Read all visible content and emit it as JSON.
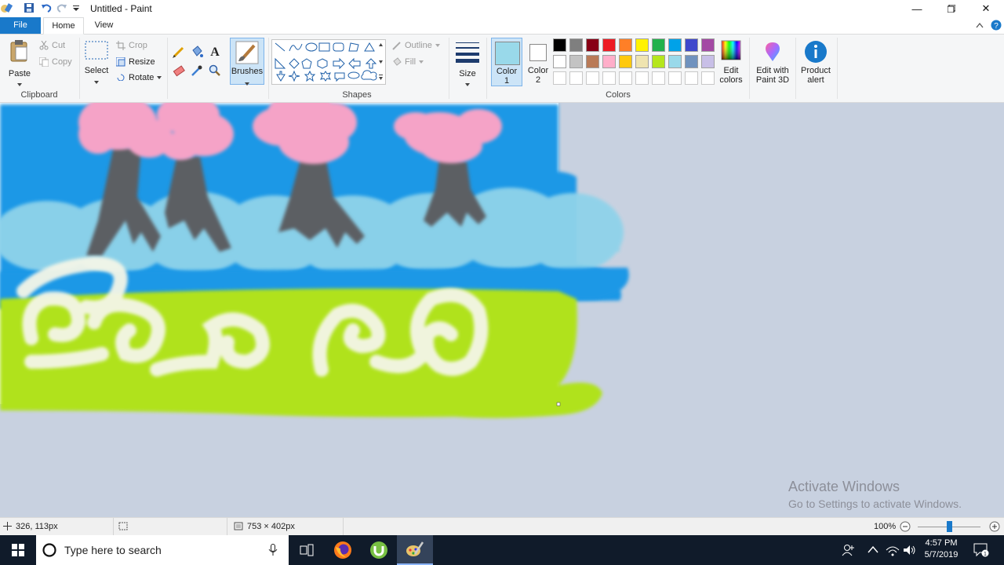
{
  "window": {
    "title": "Untitled - Paint"
  },
  "tabs": {
    "file": "File",
    "home": "Home",
    "view": "View"
  },
  "clipboard": {
    "paste": "Paste",
    "cut": "Cut",
    "copy": "Copy",
    "label": "Clipboard"
  },
  "image": {
    "select": "Select",
    "crop": "Crop",
    "resize": "Resize",
    "rotate": "Rotate"
  },
  "brushes": {
    "label": "Brushes"
  },
  "shapes": {
    "label": "Shapes",
    "outline": "Outline",
    "fill": "Fill"
  },
  "size": {
    "label": "Size"
  },
  "colors": {
    "color1": "Color 1",
    "color1_l1": "Color",
    "color1_l2": "1",
    "color2_l1": "Color",
    "color2_l2": "2",
    "label": "Colors",
    "edit_l1": "Edit",
    "edit_l2": "colors",
    "row1": [
      "#000000",
      "#7f7f7f",
      "#880015",
      "#ed1c24",
      "#ff7f27",
      "#fff200",
      "#22b14c",
      "#00a2e8",
      "#3f48cc",
      "#a349a4"
    ],
    "row2": [
      "#ffffff",
      "#c3c3c3",
      "#b97a57",
      "#ffaec9",
      "#ffc90e",
      "#efe4b0",
      "#b5e61d",
      "#99d9ea",
      "#7092be",
      "#c8bfe7"
    ],
    "color1_value": "#99d9ea",
    "color2_value": "#ffffff"
  },
  "paint3d": {
    "l1": "Edit with",
    "l2": "Paint 3D"
  },
  "product": {
    "l1": "Product",
    "l2": "alert"
  },
  "status": {
    "cursor": "326, 113px",
    "canvas_size": "753 × 402px",
    "zoom": "100%"
  },
  "watermark": {
    "line1": "Activate Windows",
    "line2": "Go to Settings to activate Windows."
  },
  "taskbar": {
    "search_placeholder": "Type here to search",
    "time": "4:57 PM",
    "date": "5/7/2019"
  }
}
